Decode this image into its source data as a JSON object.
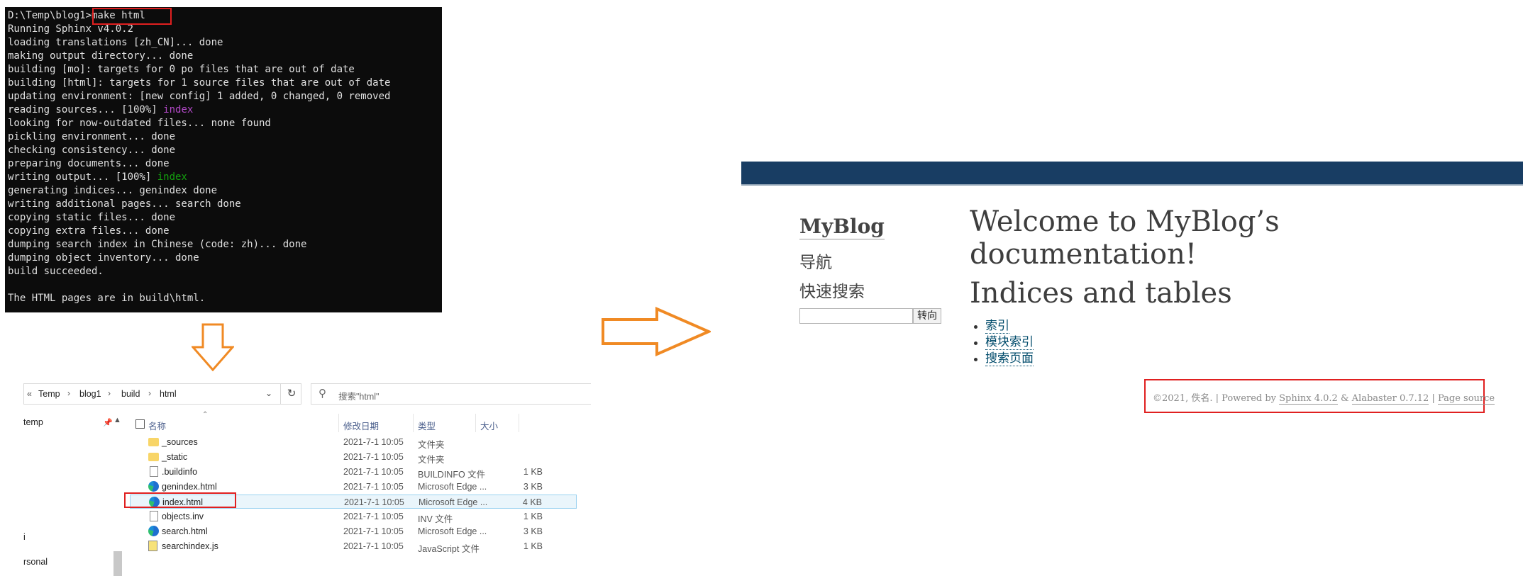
{
  "terminal": {
    "lines": [
      {
        "text": "D:\\Temp\\blog1>make html"
      },
      {
        "text": "Running Sphinx v4.0.2"
      },
      {
        "text": "loading translations [zh_CN]... done"
      },
      {
        "text": "making output directory... done"
      },
      {
        "text": "building [mo]: targets for 0 po files that are out of date"
      },
      {
        "text": "building [html]: targets for 1 source files that are out of date"
      },
      {
        "text": "updating environment: [new config] 1 added, 0 changed, 0 removed"
      },
      {
        "text": "reading sources... [100%] ",
        "tail": "index",
        "tail_color": "#b148c6"
      },
      {
        "text": "looking for now-outdated files... none found"
      },
      {
        "text": "pickling environment... done"
      },
      {
        "text": "checking consistency... done"
      },
      {
        "text": "preparing documents... done"
      },
      {
        "text": "writing output... [100%] ",
        "tail": "index",
        "tail_color": "#13a10e"
      },
      {
        "text": "generating indices... genindex done"
      },
      {
        "text": "writing additional pages... search done"
      },
      {
        "text": "copying static files... done"
      },
      {
        "text": "copying extra files... done"
      },
      {
        "text": "dumping search index in Chinese (code: zh)... done"
      },
      {
        "text": "dumping object inventory... done"
      },
      {
        "text": "build succeeded."
      },
      {
        "text": ""
      },
      {
        "text": "The HTML pages are in build\\html."
      }
    ]
  },
  "explorer": {
    "breadcrumb": {
      "overflow": "«",
      "items": [
        "Temp",
        "blog1",
        "build",
        "html"
      ],
      "separator": "›"
    },
    "search_placeholder": "搜索\"html\"",
    "nav_items": [
      "temp",
      "i",
      "rsonal"
    ],
    "columns": {
      "name": "名称",
      "date": "修改日期",
      "type": "类型",
      "size": "大小"
    },
    "files": [
      {
        "name": "_sources",
        "date": "2021-7-1 10:05",
        "type": "文件夹",
        "size": "",
        "icon": "folder-icon"
      },
      {
        "name": "_static",
        "date": "2021-7-1 10:05",
        "type": "文件夹",
        "size": "",
        "icon": "folder-icon"
      },
      {
        "name": ".buildinfo",
        "date": "2021-7-1 10:05",
        "type": "BUILDINFO 文件",
        "size": "1 KB",
        "icon": "document-icon"
      },
      {
        "name": "genindex.html",
        "date": "2021-7-1 10:05",
        "type": "Microsoft Edge ...",
        "size": "3 KB",
        "icon": "edge-icon"
      },
      {
        "name": "index.html",
        "date": "2021-7-1 10:05",
        "type": "Microsoft Edge ...",
        "size": "4 KB",
        "icon": "edge-icon"
      },
      {
        "name": "objects.inv",
        "date": "2021-7-1 10:05",
        "type": "INV 文件",
        "size": "1 KB",
        "icon": "document-icon"
      },
      {
        "name": "search.html",
        "date": "2021-7-1 10:05",
        "type": "Microsoft Edge ...",
        "size": "3 KB",
        "icon": "edge-icon"
      },
      {
        "name": "searchindex.js",
        "date": "2021-7-1 10:05",
        "type": "JavaScript 文件",
        "size": "1 KB",
        "icon": "javascript-file-icon"
      }
    ]
  },
  "sphinx": {
    "sidebar": {
      "title": "MyBlog",
      "nav_heading": "导航",
      "search_heading": "快速搜索",
      "search_button": "转向"
    },
    "heading": "Welcome to MyBlog’s documentation!",
    "indices_heading": "Indices and tables",
    "links": [
      "索引",
      "模块索引",
      "搜索页面"
    ],
    "footer": {
      "copyright": "©2021, 佚名. | Powered by ",
      "sphinx": "Sphinx 4.0.2",
      "amp": " & ",
      "alabaster": "Alabaster 0.7.12",
      "sep": " | ",
      "page_source": "Page source"
    },
    "colors": {
      "top_bar": "#183d63",
      "link": "#004b6b"
    }
  },
  "annotations": {
    "highlight_color": "#e02020",
    "arrow_color": "#f08a24"
  }
}
